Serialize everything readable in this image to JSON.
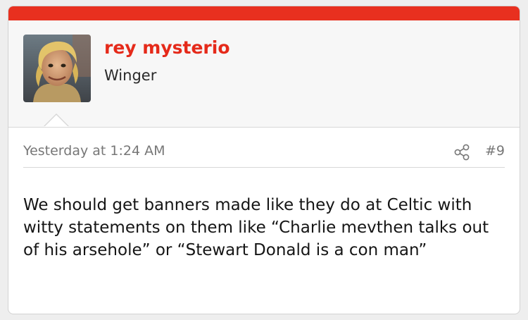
{
  "post": {
    "author": {
      "username": "rey mysterio",
      "title": "Winger"
    },
    "timestamp": "Yesterday at 1:24 AM",
    "post_number": "#9",
    "body": "We should get banners made like they do at Celtic with witty statements on them like “Charlie mevthen talks out of his arsehole” or “Stewart Donald is a con man”",
    "icons": {
      "share": "share-icon",
      "avatar": "avatar"
    }
  },
  "colors": {
    "accent": "#e8301f",
    "username": "#e52a1a",
    "meta_text": "#777777",
    "body_text": "#151515"
  }
}
